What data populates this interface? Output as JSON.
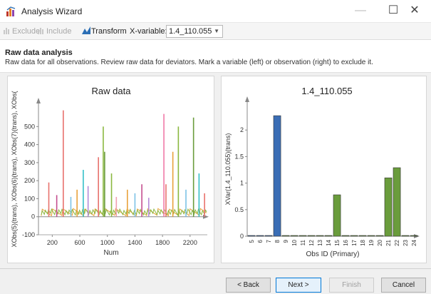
{
  "window": {
    "title": "Analysis Wizard",
    "minimize_glyph": "—",
    "maximize_glyph": "☐",
    "close_glyph": "✕"
  },
  "toolbar": {
    "exclude_label": "Exclude",
    "include_label": "Include",
    "transform_label": "Transform",
    "xvariable_label": "X-variable:",
    "xvariable_value": "1.4_110.055"
  },
  "header": {
    "title": "Raw data analysis",
    "description": "Raw data for all observations. Review raw data for deviators. Mark a variable (left) or observation (right) to exclude it."
  },
  "footer": {
    "back_label": "< Back",
    "next_label": "Next >",
    "finish_label": "Finish",
    "cancel_label": "Cancel"
  },
  "colors": {
    "bar_blue": "#3a6db5",
    "bar_green": "#6a9c3c",
    "accent": "#0078d7"
  },
  "chart_data": [
    {
      "type": "line",
      "title": "Raw data",
      "xlabel": "Num",
      "ylabel": "XObs(5)(trans), XObs(6)(trans), XObs(7)(trans), XObs(",
      "xlim": [
        0,
        2450
      ],
      "ylim": [
        -100,
        620
      ],
      "x_ticks": [
        200,
        600,
        1000,
        1400,
        1800,
        2200
      ],
      "y_ticks": [
        -100,
        0,
        100,
        200,
        300,
        400,
        500
      ],
      "spikes": [
        {
          "x": 150,
          "y": 190,
          "color": "#e8716c"
        },
        {
          "x": 265,
          "y": 120,
          "color": "#c44e8f"
        },
        {
          "x": 360,
          "y": 590,
          "color": "#e8716c"
        },
        {
          "x": 470,
          "y": 110,
          "color": "#7cc2e6"
        },
        {
          "x": 560,
          "y": 150,
          "color": "#e8a13a"
        },
        {
          "x": 650,
          "y": 260,
          "color": "#34c0c8"
        },
        {
          "x": 720,
          "y": 170,
          "color": "#b58ad8"
        },
        {
          "x": 870,
          "y": 330,
          "color": "#e8716c"
        },
        {
          "x": 940,
          "y": 500,
          "color": "#8bb840"
        },
        {
          "x": 960,
          "y": 360,
          "color": "#6a9c3c"
        },
        {
          "x": 1060,
          "y": 240,
          "color": "#8bb840"
        },
        {
          "x": 1130,
          "y": 110,
          "color": "#f0a0b0"
        },
        {
          "x": 1290,
          "y": 150,
          "color": "#e8a13a"
        },
        {
          "x": 1400,
          "y": 130,
          "color": "#7cc2e6"
        },
        {
          "x": 1500,
          "y": 180,
          "color": "#c44e8f"
        },
        {
          "x": 1600,
          "y": 105,
          "color": "#b58ad8"
        },
        {
          "x": 1820,
          "y": 570,
          "color": "#f07aa8"
        },
        {
          "x": 1850,
          "y": 180,
          "color": "#e8716c"
        },
        {
          "x": 1950,
          "y": 360,
          "color": "#e8a13a"
        },
        {
          "x": 2030,
          "y": 500,
          "color": "#8bb840"
        },
        {
          "x": 2140,
          "y": 150,
          "color": "#7cc2e6"
        },
        {
          "x": 2250,
          "y": 550,
          "color": "#6a9c3c"
        },
        {
          "x": 2330,
          "y": 240,
          "color": "#34c0c8"
        },
        {
          "x": 2410,
          "y": 130,
          "color": "#e8716c"
        }
      ]
    },
    {
      "type": "bar",
      "title": "1.4_110.055",
      "xlabel": "Obs ID (Primary)",
      "ylabel": "XVar(1.4_110.055)(trans)",
      "categories": [
        "5",
        "6",
        "7",
        "8",
        "9",
        "10",
        "11",
        "12",
        "13",
        "14",
        "15",
        "16",
        "17",
        "18",
        "19",
        "20",
        "21",
        "22",
        "23",
        "24"
      ],
      "values": [
        0,
        0,
        0,
        2.27,
        0,
        0,
        0,
        0,
        0,
        0,
        0.78,
        0,
        0,
        0,
        0,
        0,
        1.1,
        1.29,
        0,
        0
      ],
      "colors": [
        "#3a6db5",
        "#3a6db5",
        "#3a6db5",
        "#3a6db5",
        "#6a9c3c",
        "#6a9c3c",
        "#6a9c3c",
        "#6a9c3c",
        "#6a9c3c",
        "#6a9c3c",
        "#6a9c3c",
        "#6a9c3c",
        "#6a9c3c",
        "#6a9c3c",
        "#6a9c3c",
        "#6a9c3c",
        "#6a9c3c",
        "#6a9c3c",
        "#6a9c3c",
        "#6a9c3c"
      ],
      "ylim": [
        0,
        2.5
      ],
      "y_ticks": [
        0,
        0.5,
        1,
        1.5,
        2
      ]
    }
  ]
}
